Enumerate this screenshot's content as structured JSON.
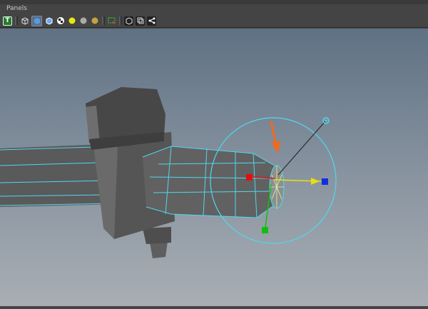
{
  "menubar": {
    "panels_label": "Panels"
  },
  "toolbar": {
    "icons": [
      "text-icon",
      "wireframe-cube-icon",
      "smooth-shade-cube-icon",
      "shaded-wire-cube-icon",
      "checker-icon",
      "light-yellow-sphere-icon",
      "gray-sphere-icon",
      "gold-sphere-icon",
      "select-region-icon",
      "isolate-cube-icon",
      "xray-icon",
      "hierarchy-icon"
    ],
    "text_icon_label": "T"
  },
  "colors": {
    "wire": "#4fd8ee",
    "arrow": "#f06a1e",
    "x_axis": "#e01010",
    "y_axis": "#10c010",
    "z_axis": "#1030e0",
    "move": "#e8e010"
  }
}
